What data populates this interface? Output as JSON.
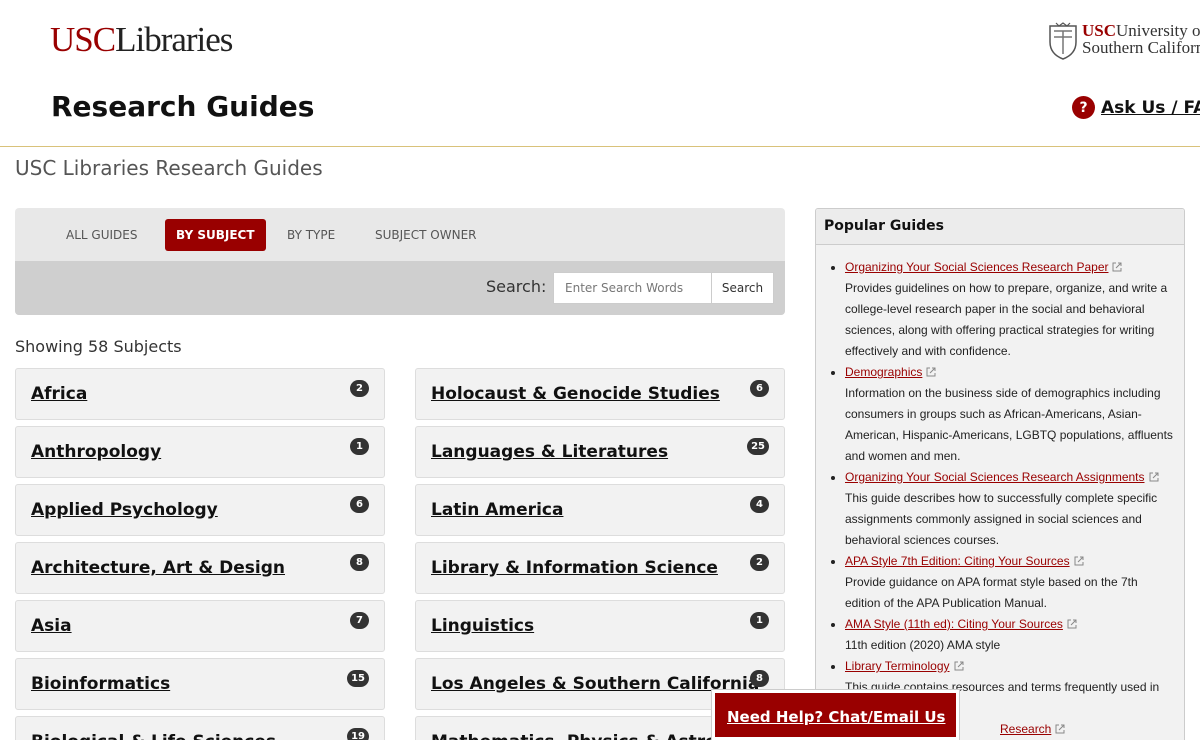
{
  "header": {
    "logo_usc": "USC",
    "logo_libraries": "Libraries",
    "university_usc": "USC",
    "university_line1": "University of",
    "university_line2": "Southern California",
    "section_title": "Research Guides",
    "ask_us_icon": "question-circle-icon",
    "ask_us_label": "Ask Us / FAQ"
  },
  "page_title": "USC Libraries Research Guides",
  "tabs": [
    {
      "label": "ALL GUIDES",
      "active": false
    },
    {
      "label": "BY SUBJECT",
      "active": true
    },
    {
      "label": "BY TYPE",
      "active": false
    },
    {
      "label": "SUBJECT OWNER",
      "active": false
    }
  ],
  "search": {
    "label": "Search:",
    "placeholder": "Enter Search Words",
    "button_label": "Search"
  },
  "showing": "Showing 58 Subjects",
  "subjects_left": [
    {
      "name": "Africa",
      "count": "2"
    },
    {
      "name": "Anthropology",
      "count": "1"
    },
    {
      "name": "Applied Psychology",
      "count": "6"
    },
    {
      "name": "Architecture, Art & Design",
      "count": "8"
    },
    {
      "name": "Asia",
      "count": "7"
    },
    {
      "name": "Bioinformatics",
      "count": "15"
    },
    {
      "name": "Biological & Life Sciences",
      "count": "19"
    }
  ],
  "subjects_right": [
    {
      "name": "Holocaust & Genocide Studies",
      "count": "6"
    },
    {
      "name": "Languages & Literatures",
      "count": "25"
    },
    {
      "name": "Latin America",
      "count": "4"
    },
    {
      "name": "Library & Information Science",
      "count": "2"
    },
    {
      "name": "Linguistics",
      "count": "1"
    },
    {
      "name": "Los Angeles & Southern California",
      "count": "8"
    },
    {
      "name": "Mathematics, Physics & Astronomy",
      "count": ""
    }
  ],
  "popular": {
    "heading": "Popular Guides",
    "items": [
      {
        "title": "Organizing Your Social Sciences Research Paper",
        "desc": "Provides guidelines on how to prepare, organize, and write a college-level research paper in the social and behavioral sciences, along with offering practical strategies for writing effectively and with confidence."
      },
      {
        "title": "Demographics",
        "desc": "Information on the business side of demographics including consumers in groups such as African-Americans, Asian-American, Hispanic-Americans, LGBTQ populations, affluents and women and men."
      },
      {
        "title": "Organizing Your Social Sciences Research Assignments",
        "desc": "This guide describes how to successfully complete specific assignments commonly assigned in social sciences and behavioral sciences courses."
      },
      {
        "title": "APA Style 7th Edition: Citing Your Sources",
        "desc": "Provide guidance on APA format style based on the 7th edition of the APA Publication Manual."
      },
      {
        "title": "AMA Style (11th ed): Citing Your Sources",
        "desc": "11th edition (2020) AMA style"
      },
      {
        "title": "Library Terminology",
        "desc": "This guide contains resources and terms frequently used in the"
      },
      {
        "title": "Research",
        "desc": ""
      }
    ]
  },
  "help_label": "Need Help? Chat/Email Us",
  "colors": {
    "accent": "#990000",
    "gold_rule": "#d9c27a"
  }
}
